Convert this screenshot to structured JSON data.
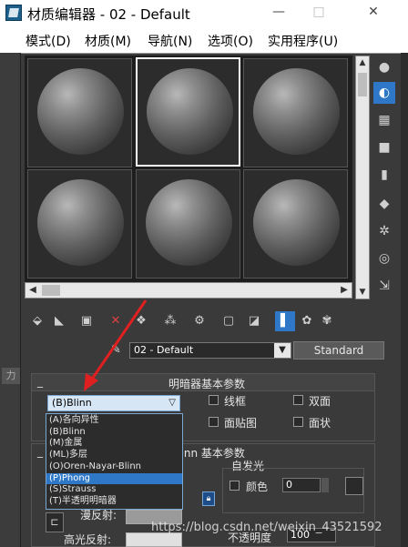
{
  "window": {
    "title": "材质编辑器 - 02 - Default",
    "minimize": "—",
    "maximize": "□",
    "close": "✕"
  },
  "menubar": {
    "items": [
      "模式(D)",
      "材质(M)",
      "导航(N)",
      "选项(O)",
      "实用程序(U)"
    ]
  },
  "material": {
    "name": "02 - Default",
    "type_button": "Standard"
  },
  "rollouts": {
    "shader_basic_title": "明暗器基本参数",
    "blinn_basic_title_partial": "Blinn 基本参数"
  },
  "shader": {
    "current": "(B)Blinn",
    "options": [
      "(A)各向异性",
      "(B)Blinn",
      "(M)金属",
      "(ML)多层",
      "(O)Oren-Nayar-Blinn",
      "(P)Phong",
      "(S)Strauss",
      "(T)半透明明暗器"
    ],
    "highlighted_index": 5
  },
  "checkboxes": {
    "wire": "线框",
    "two_sided": "双面",
    "face_map": "面贴图",
    "faceted": "面状"
  },
  "self_illumination": {
    "title": "自发光",
    "color_label": "颜色",
    "value": "0"
  },
  "labels": {
    "diffuse": "漫反射:",
    "specular": "高光反射:",
    "opacity_partial": "不透明度",
    "opacity_value": "100",
    "side_tab": "力"
  },
  "watermark": "https://blog.csdn.net/weixin_43521592",
  "colors": {
    "accent": "#2e78c7",
    "arrow": "#e02020",
    "panel_bg": "#3a3a3a"
  }
}
